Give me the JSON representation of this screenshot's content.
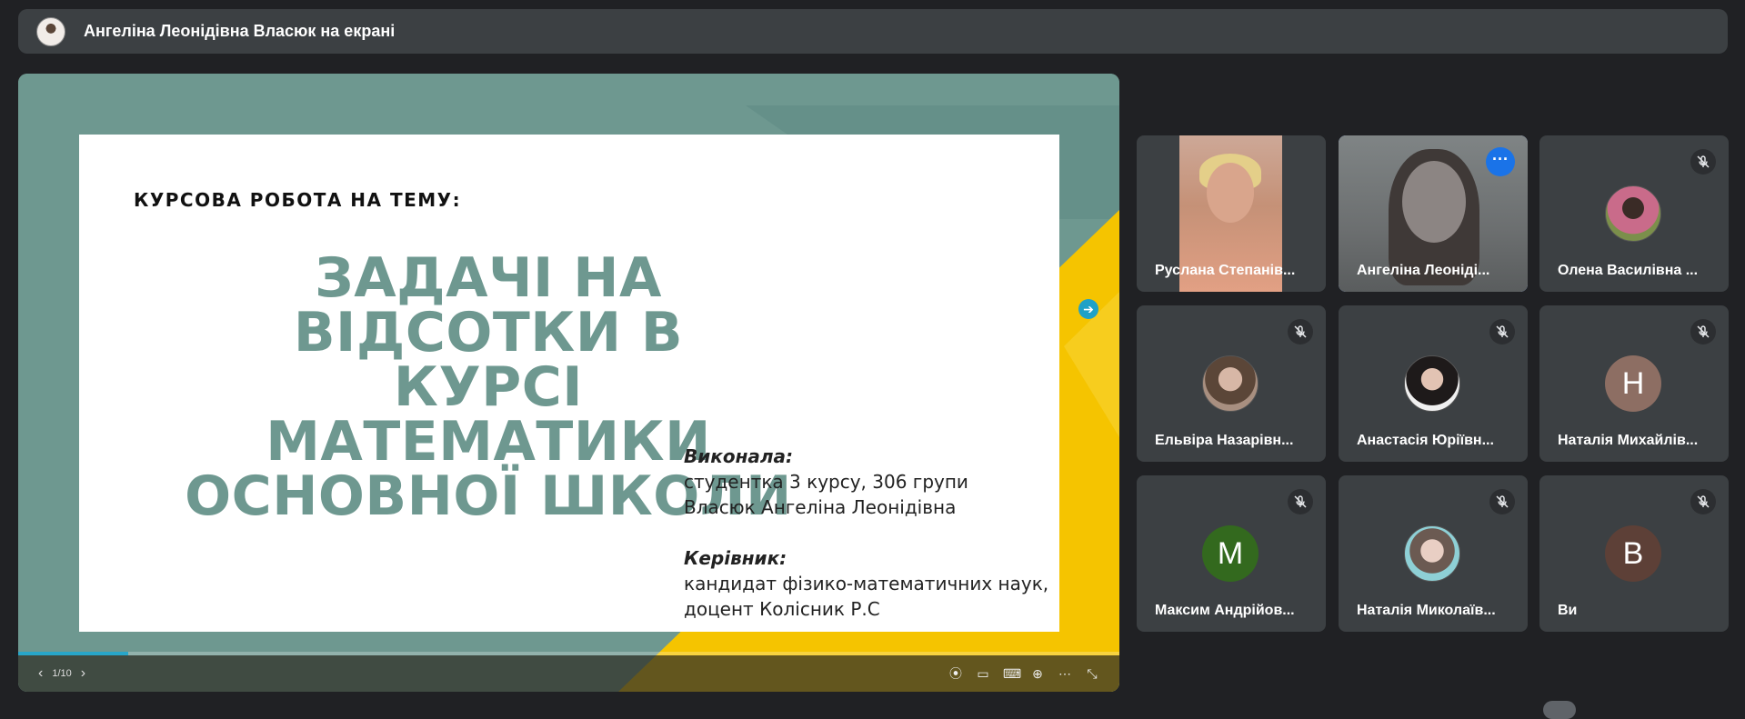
{
  "banner": {
    "text": "Ангеліна Леонідівна Власюк на екрані"
  },
  "slide": {
    "kicker": "КУРСОВА РОБОТА НА ТЕМУ:",
    "title_lines": [
      "ЗАДАЧІ НА ВІДСОТКИ В",
      "КУРСІ МАТЕМАТИКИ",
      "ОСНОВНОЇ ШКОЛИ"
    ],
    "performer_label": "Виконала:",
    "performer_lines": [
      "студентка 3 курсу, 306 групи",
      "Власюк Ангеліна Леонідівна"
    ],
    "supervisor_label": "Керівник:",
    "supervisor_lines": [
      "кандидат фізико-математичних наук,",
      "доцент Колісник Р.С"
    ]
  },
  "controls": {
    "page": "1/10",
    "progress_fraction": 0.1
  },
  "participants": [
    {
      "name": "Руслана Степанів...",
      "type": "video",
      "muted": false
    },
    {
      "name": "Ангеліна Леоніді...",
      "type": "video",
      "muted": false,
      "active": true
    },
    {
      "name": "Олена Василівна ...",
      "type": "photo",
      "muted": true
    },
    {
      "name": "Ельвіра Назарівн...",
      "type": "photo",
      "muted": true
    },
    {
      "name": "Анастасія Юріївн...",
      "type": "photo",
      "muted": true
    },
    {
      "name": "Наталія Михайлів...",
      "type": "initial",
      "initial": "Н",
      "color": "#8d6e63",
      "muted": true
    },
    {
      "name": "Максим Андрійов...",
      "type": "initial",
      "initial": "М",
      "color": "#33691e",
      "muted": true
    },
    {
      "name": "Наталія Миколаїв...",
      "type": "photo",
      "muted": true
    },
    {
      "name": "Ви",
      "type": "initial",
      "initial": "В",
      "color": "#5d4037",
      "muted": true
    }
  ],
  "colors": {
    "accent_teal": "#6e9890",
    "accent_yellow": "#f5c400",
    "active_outline": "#8ab4f8"
  }
}
